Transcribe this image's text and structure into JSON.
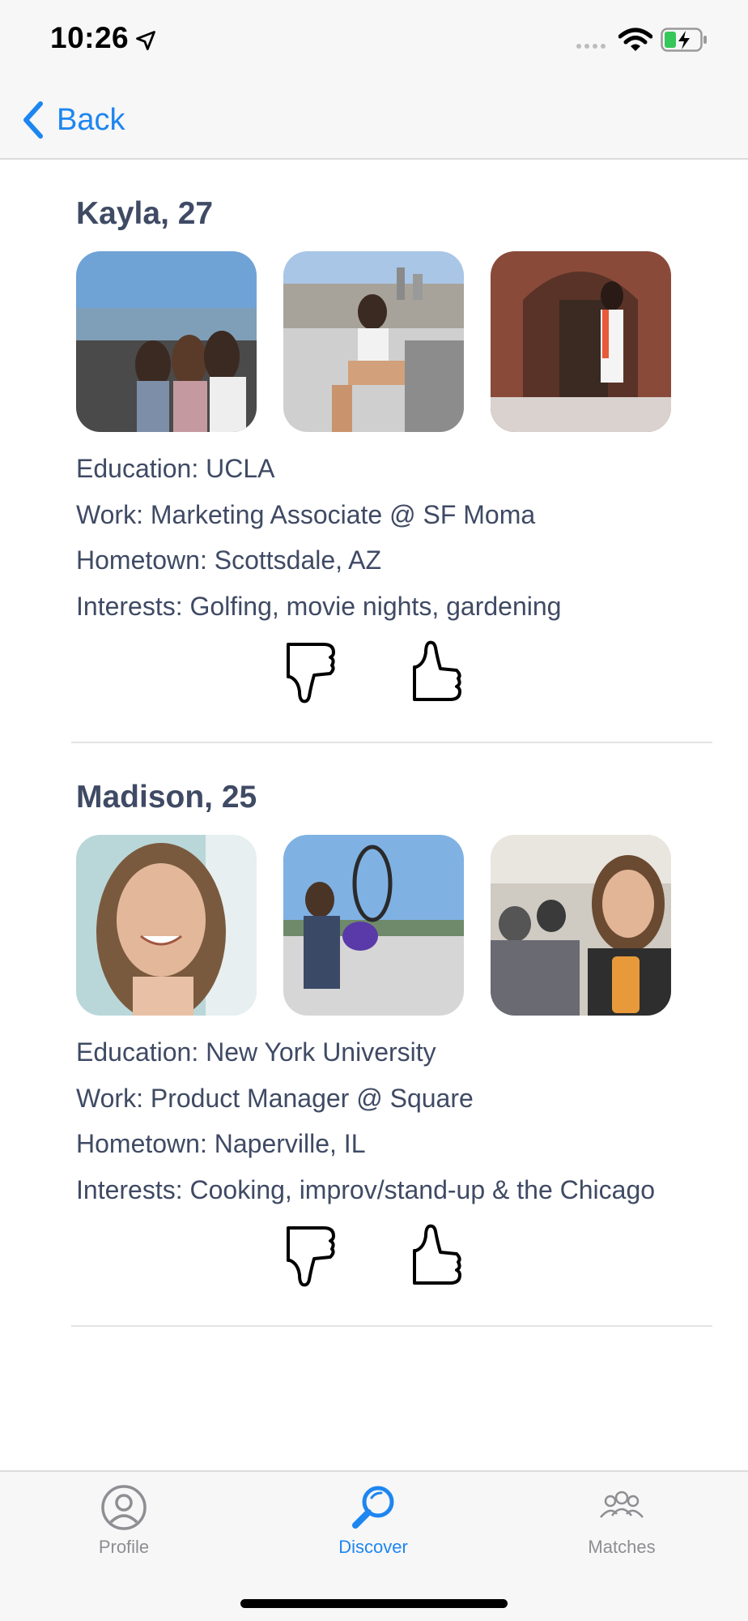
{
  "status_bar": {
    "time": "10:26"
  },
  "nav": {
    "back_label": "Back"
  },
  "profiles": [
    {
      "name": "Kayla, 27",
      "photos": [
        "three-friends-by-water-photo",
        "woman-sitting-city-skyline-photo",
        "woman-graduation-lei-photo"
      ],
      "details": [
        "Education: UCLA",
        "Work: Marketing Associate @ SF Moma",
        "Hometown: Scottsdale, AZ",
        "Interests: Golfing, movie nights, gardening"
      ]
    },
    {
      "name": "Madison, 25",
      "photos": [
        "smiling-woman-selfie-photo",
        "woman-with-flowers-sculpture-photo",
        "woman-with-beer-restaurant-photo"
      ],
      "details": [
        "Education: New York University",
        "Work: Product Manager @ Square",
        "Hometown: Naperville, IL",
        "Interests: Cooking, improv/stand-up & the Chicago"
      ]
    }
  ],
  "tabbar": {
    "tabs": [
      {
        "label": "Profile",
        "icon": "person-circle-icon",
        "active": false
      },
      {
        "label": "Discover",
        "icon": "search-icon",
        "active": true
      },
      {
        "label": "Matches",
        "icon": "people-group-icon",
        "active": false
      }
    ]
  },
  "colors": {
    "accent": "#1d86f0",
    "text": "#3f4a64",
    "inactive": "#8e8e93"
  }
}
